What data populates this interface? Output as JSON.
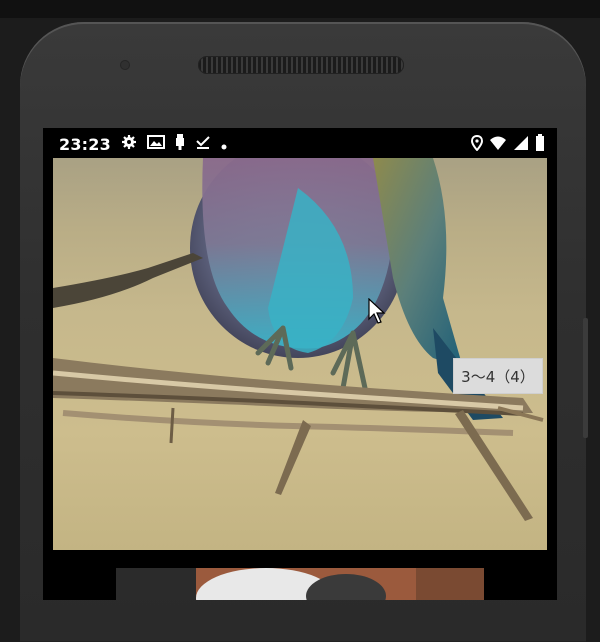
{
  "status_bar": {
    "time": "23:23",
    "left_icons": [
      "gear-icon",
      "image-icon",
      "usb-icon",
      "download-done-icon",
      "dot-icon"
    ],
    "right_icons": [
      "location-icon",
      "wifi-icon",
      "signal-icon",
      "battery-icon"
    ]
  },
  "photo": {
    "subject": "bird-on-branch"
  },
  "tooltip": {
    "text": "3〜4（4）"
  }
}
